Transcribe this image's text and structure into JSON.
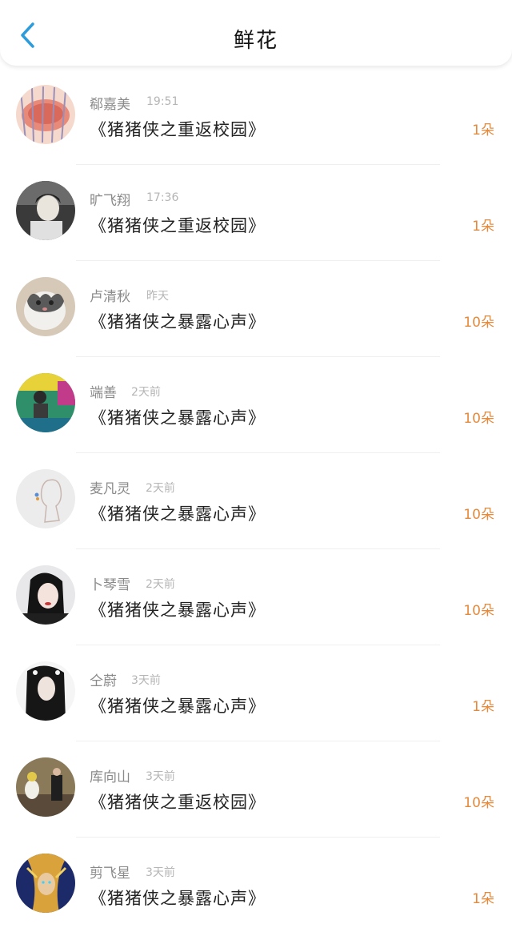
{
  "header": {
    "title": "鲜花",
    "back_icon": "chevron-left-icon",
    "accent": "#2d9cdb"
  },
  "colors": {
    "count": "#e58a3c",
    "name": "#8a8a8a",
    "time": "#b5b5b5"
  },
  "items": [
    {
      "name": "郗嘉美",
      "time": "19:51",
      "work": "《猪猪侠之重返校园》",
      "count": "1朵"
    },
    {
      "name": "旷飞翔",
      "time": "17:36",
      "work": "《猪猪侠之重返校园》",
      "count": "1朵"
    },
    {
      "name": "卢清秋",
      "time": "昨天",
      "work": "《猪猪侠之暴露心声》",
      "count": "10朵"
    },
    {
      "name": "端善",
      "time": "2天前",
      "work": "《猪猪侠之暴露心声》",
      "count": "10朵"
    },
    {
      "name": "麦凡灵",
      "time": "2天前",
      "work": "《猪猪侠之暴露心声》",
      "count": "10朵"
    },
    {
      "name": "卜琴雪",
      "time": "2天前",
      "work": "《猪猪侠之暴露心声》",
      "count": "10朵"
    },
    {
      "name": "仝蔚",
      "time": "3天前",
      "work": "《猪猪侠之暴露心声》",
      "count": "1朵"
    },
    {
      "name": "库向山",
      "time": "3天前",
      "work": "《猪猪侠之重返校园》",
      "count": "10朵"
    },
    {
      "name": "剪飞星",
      "time": "3天前",
      "work": "《猪猪侠之暴露心声》",
      "count": "1朵"
    }
  ]
}
